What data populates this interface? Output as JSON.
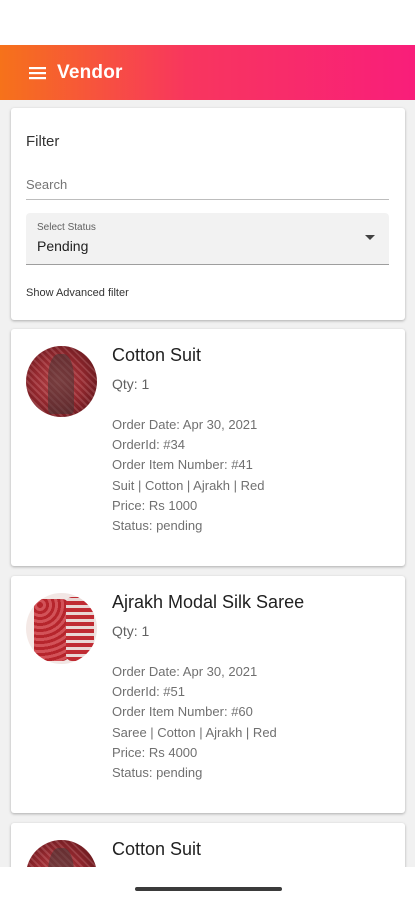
{
  "appbar": {
    "title": "Vendor",
    "menu_icon": "hamburger-menu-icon",
    "gradient": [
      "#f6721a",
      "#f91e7a"
    ]
  },
  "filter": {
    "title": "Filter",
    "search_placeholder": "Search",
    "status": {
      "label": "Select Status",
      "value": "Pending"
    },
    "advanced_label": "Show Advanced filter"
  },
  "orders": [
    {
      "name": "Cotton Suit",
      "qty": "Qty: 1",
      "order_date": "Order Date: Apr 30, 2021",
      "order_id": "OrderId: #34",
      "item_number": "Order Item Number: #41",
      "attributes": "Suit | Cotton | Ajrakh | Red",
      "price": "Price: Rs 1000",
      "status": "Status: pending"
    },
    {
      "name": "Ajrakh Modal Silk Saree",
      "qty": "Qty: 1",
      "order_date": "Order Date: Apr 30, 2021",
      "order_id": "OrderId: #51",
      "item_number": "Order Item Number: #60",
      "attributes": "Saree | Cotton | Ajrakh | Red",
      "price": "Price: Rs 4000",
      "status": "Status: pending"
    },
    {
      "name": "Cotton Suit"
    }
  ]
}
